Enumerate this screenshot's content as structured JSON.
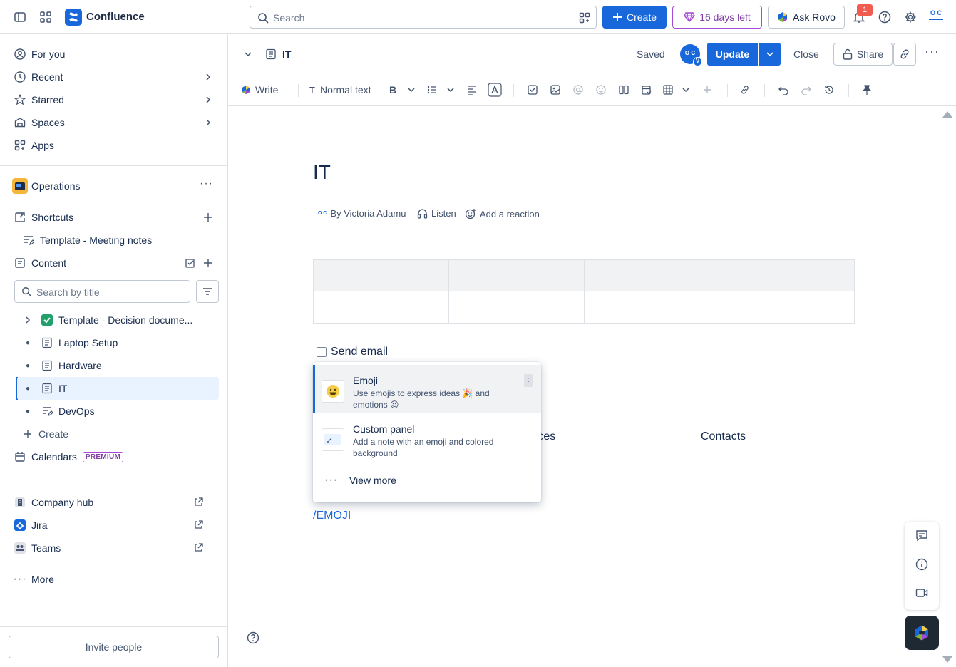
{
  "topbar": {
    "app_name": "Confluence",
    "search_placeholder": "Search",
    "create_label": "Create",
    "trial_label": "16 days left",
    "rovo_label": "Ask Rovo",
    "notification_count": "1",
    "avatar_initials": "O C"
  },
  "sidebar": {
    "nav": [
      {
        "label": "For you",
        "icon": "user-circle-icon"
      },
      {
        "label": "Recent",
        "icon": "clock-icon"
      },
      {
        "label": "Starred",
        "icon": "star-icon"
      },
      {
        "label": "Spaces",
        "icon": "spaces-icon"
      },
      {
        "label": "Apps",
        "icon": "apps-icon"
      }
    ],
    "space_name": "Operations",
    "shortcuts_label": "Shortcuts",
    "shortcut_item": "Template - Meeting notes",
    "content_label": "Content",
    "search_placeholder": "Search by title",
    "tree": [
      {
        "label": "Template - Decision docume...",
        "icon": "checkbox-icon"
      },
      {
        "label": "Laptop Setup",
        "icon": "page-icon"
      },
      {
        "label": "Hardware",
        "icon": "page-icon"
      },
      {
        "label": "IT",
        "icon": "page-icon",
        "selected": true
      },
      {
        "label": "DevOps",
        "icon": "live-doc-icon"
      }
    ],
    "create_label": "Create",
    "calendars_label": "Calendars",
    "premium_label": "PREMIUM",
    "apps": [
      {
        "label": "Company hub"
      },
      {
        "label": "Jira"
      },
      {
        "label": "Teams"
      }
    ],
    "more_label": "More",
    "invite_label": "Invite people"
  },
  "editor_header": {
    "page_name": "IT",
    "saved_label": "Saved",
    "update_label": "Update",
    "close_label": "Close",
    "share_label": "Share",
    "avatar_initials": "O C",
    "avatar_badge": "V"
  },
  "toolbar": {
    "write_label": "Write",
    "text_style_label": "Normal text"
  },
  "page": {
    "title": "IT",
    "author": "By Victoria Adamu",
    "listen_label": "Listen",
    "reaction_label": "Add a reaction",
    "task_label": "Send email",
    "partial_text_1": "rces",
    "partial_text_2": "Contacts",
    "slash_command": "/EMOJI"
  },
  "popup": {
    "items": [
      {
        "title": "Emoji",
        "desc": "Use emojis to express ideas 🎉 and emotions 😍",
        "icon": "😀",
        "shortcut": ":"
      },
      {
        "title": "Custom panel",
        "desc": "Add a note with an emoji and colored background",
        "icon": "custom-panel-icon"
      }
    ],
    "view_more_label": "View more"
  },
  "colors": {
    "brand": "#1868db",
    "premium": "#a54ad4",
    "selected_bg": "#e9f2ff"
  }
}
